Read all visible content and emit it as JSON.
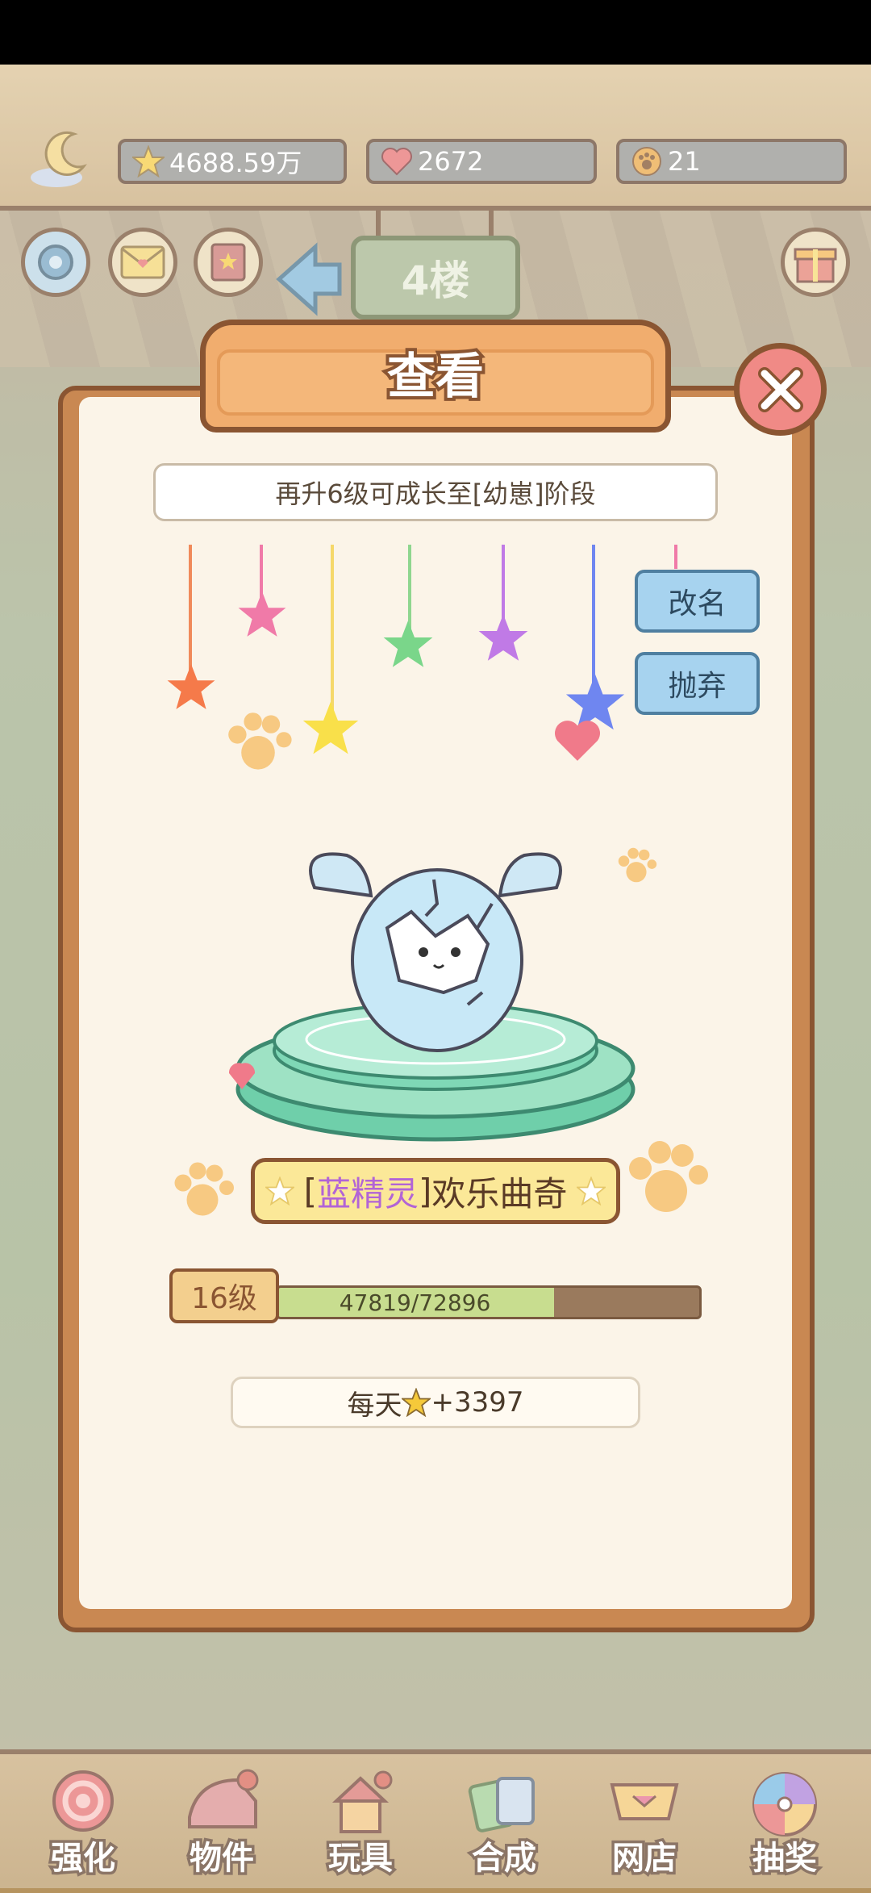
{
  "resources": {
    "stars": "4688.59万",
    "hearts": "2672",
    "coins": "21"
  },
  "floor": {
    "label": "4楼"
  },
  "dialog": {
    "title": "查看",
    "growth_hint": "再升6级可成长至[幼崽]阶段",
    "rename_label": "改名",
    "abandon_label": "抛弃",
    "pet_name_open": "[",
    "pet_name_species": "蓝精灵",
    "pet_name_close": "]",
    "pet_name_nick": "欢乐曲奇",
    "level_label": "16级",
    "xp_text": "47819/72896",
    "xp_fraction": 0.656,
    "daily_prefix": "每天",
    "daily_value": "+3397"
  },
  "nav": [
    {
      "label": "强化",
      "color": "#e46b6b"
    },
    {
      "label": "物件",
      "color": "#d98a8a"
    },
    {
      "label": "玩具",
      "color": "#e2a06b"
    },
    {
      "label": "合成",
      "color": "#8cc4b4"
    },
    {
      "label": "网店",
      "color": "#e6b870"
    },
    {
      "label": "抽奖",
      "color": "#d9a6e0"
    }
  ],
  "colors": {
    "dialog_frame": "#c98852",
    "dialog_bg": "#fbf4e8",
    "button_blue": "#a7d3ef",
    "xp_fill": "#c8dd8f"
  }
}
